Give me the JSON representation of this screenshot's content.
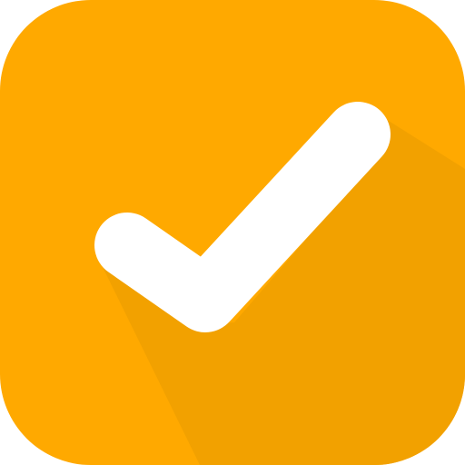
{
  "icon": {
    "name": "checkmark-icon",
    "colors": {
      "tile": "#FFA900",
      "shadow": "#F2A100",
      "check": "#FFFFFF"
    }
  }
}
